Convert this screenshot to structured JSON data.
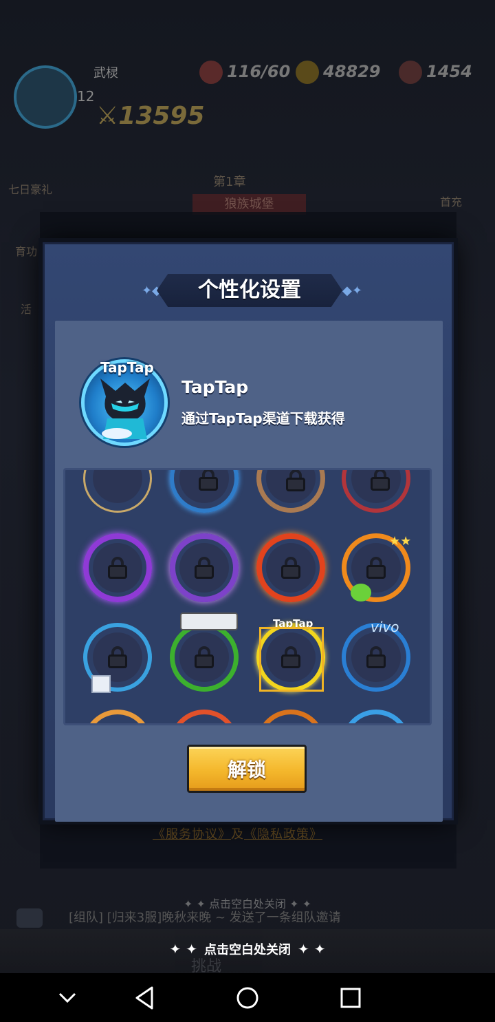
{
  "background": {
    "player_name": "武棂",
    "player_level": "12",
    "power": "13595",
    "resources": [
      {
        "icon": "stamina-icon",
        "value": "116/60"
      },
      {
        "icon": "gold-icon",
        "value": "48829"
      },
      {
        "icon": "gem-icon",
        "value": "1454"
      }
    ],
    "left_menu": [
      "七日豪礼",
      "育功",
      "活"
    ],
    "right_menu": [
      "首充"
    ],
    "chapter": "第1章",
    "stage_name": "狼族城堡",
    "policy_text_1": "《服务协议》",
    "policy_join": "及",
    "policy_text_2": "《隐私政策》",
    "faded_hint": "点击空白处关闭",
    "chat_message": "[组队] [归来3服]晚秋来晚 ~ 发送了一条组队邀请",
    "bottom_label": "挑战"
  },
  "modal": {
    "title": "个性化设置",
    "preview": {
      "tag": "TapTap",
      "name": "TapTap",
      "description": "通过TapTap渠道下载获得"
    },
    "frames": [
      {
        "style": "plain-gold",
        "locked": false
      },
      {
        "style": "blue-ox",
        "locked": true
      },
      {
        "style": "rope",
        "locked": true
      },
      {
        "style": "red-crystal",
        "locked": true
      },
      {
        "style": "purple-flame",
        "locked": true
      },
      {
        "style": "purple-dragon",
        "locked": true
      },
      {
        "style": "fire-sword",
        "locked": true
      },
      {
        "style": "orange-stars",
        "locked": true
      },
      {
        "style": "blue-cube",
        "locked": true
      },
      {
        "style": "green-camera",
        "locked": true
      },
      {
        "style": "taptap-yellow",
        "locked": true,
        "selected": true,
        "label": "TapTap"
      },
      {
        "style": "vivo-blue",
        "locked": true,
        "label": "vivo"
      },
      {
        "style": "orange-partial",
        "locked": false
      },
      {
        "style": "red-partial",
        "locked": false
      },
      {
        "style": "orange2-partial",
        "locked": false
      },
      {
        "style": "blue-partial",
        "locked": false
      }
    ],
    "unlock_label": "解锁"
  },
  "close_hint": "点击空白处关闭",
  "navbar": {
    "back": "back-icon",
    "home": "home-icon",
    "recent": "recent-apps-icon",
    "collapse": "chevron-down-icon"
  },
  "colors": {
    "modal_bg": "#334772",
    "panel_bg": "#4f6287",
    "grid_bg": "#2e3f66",
    "button_gold": "#f4b72c",
    "selection": "#f0b425"
  }
}
